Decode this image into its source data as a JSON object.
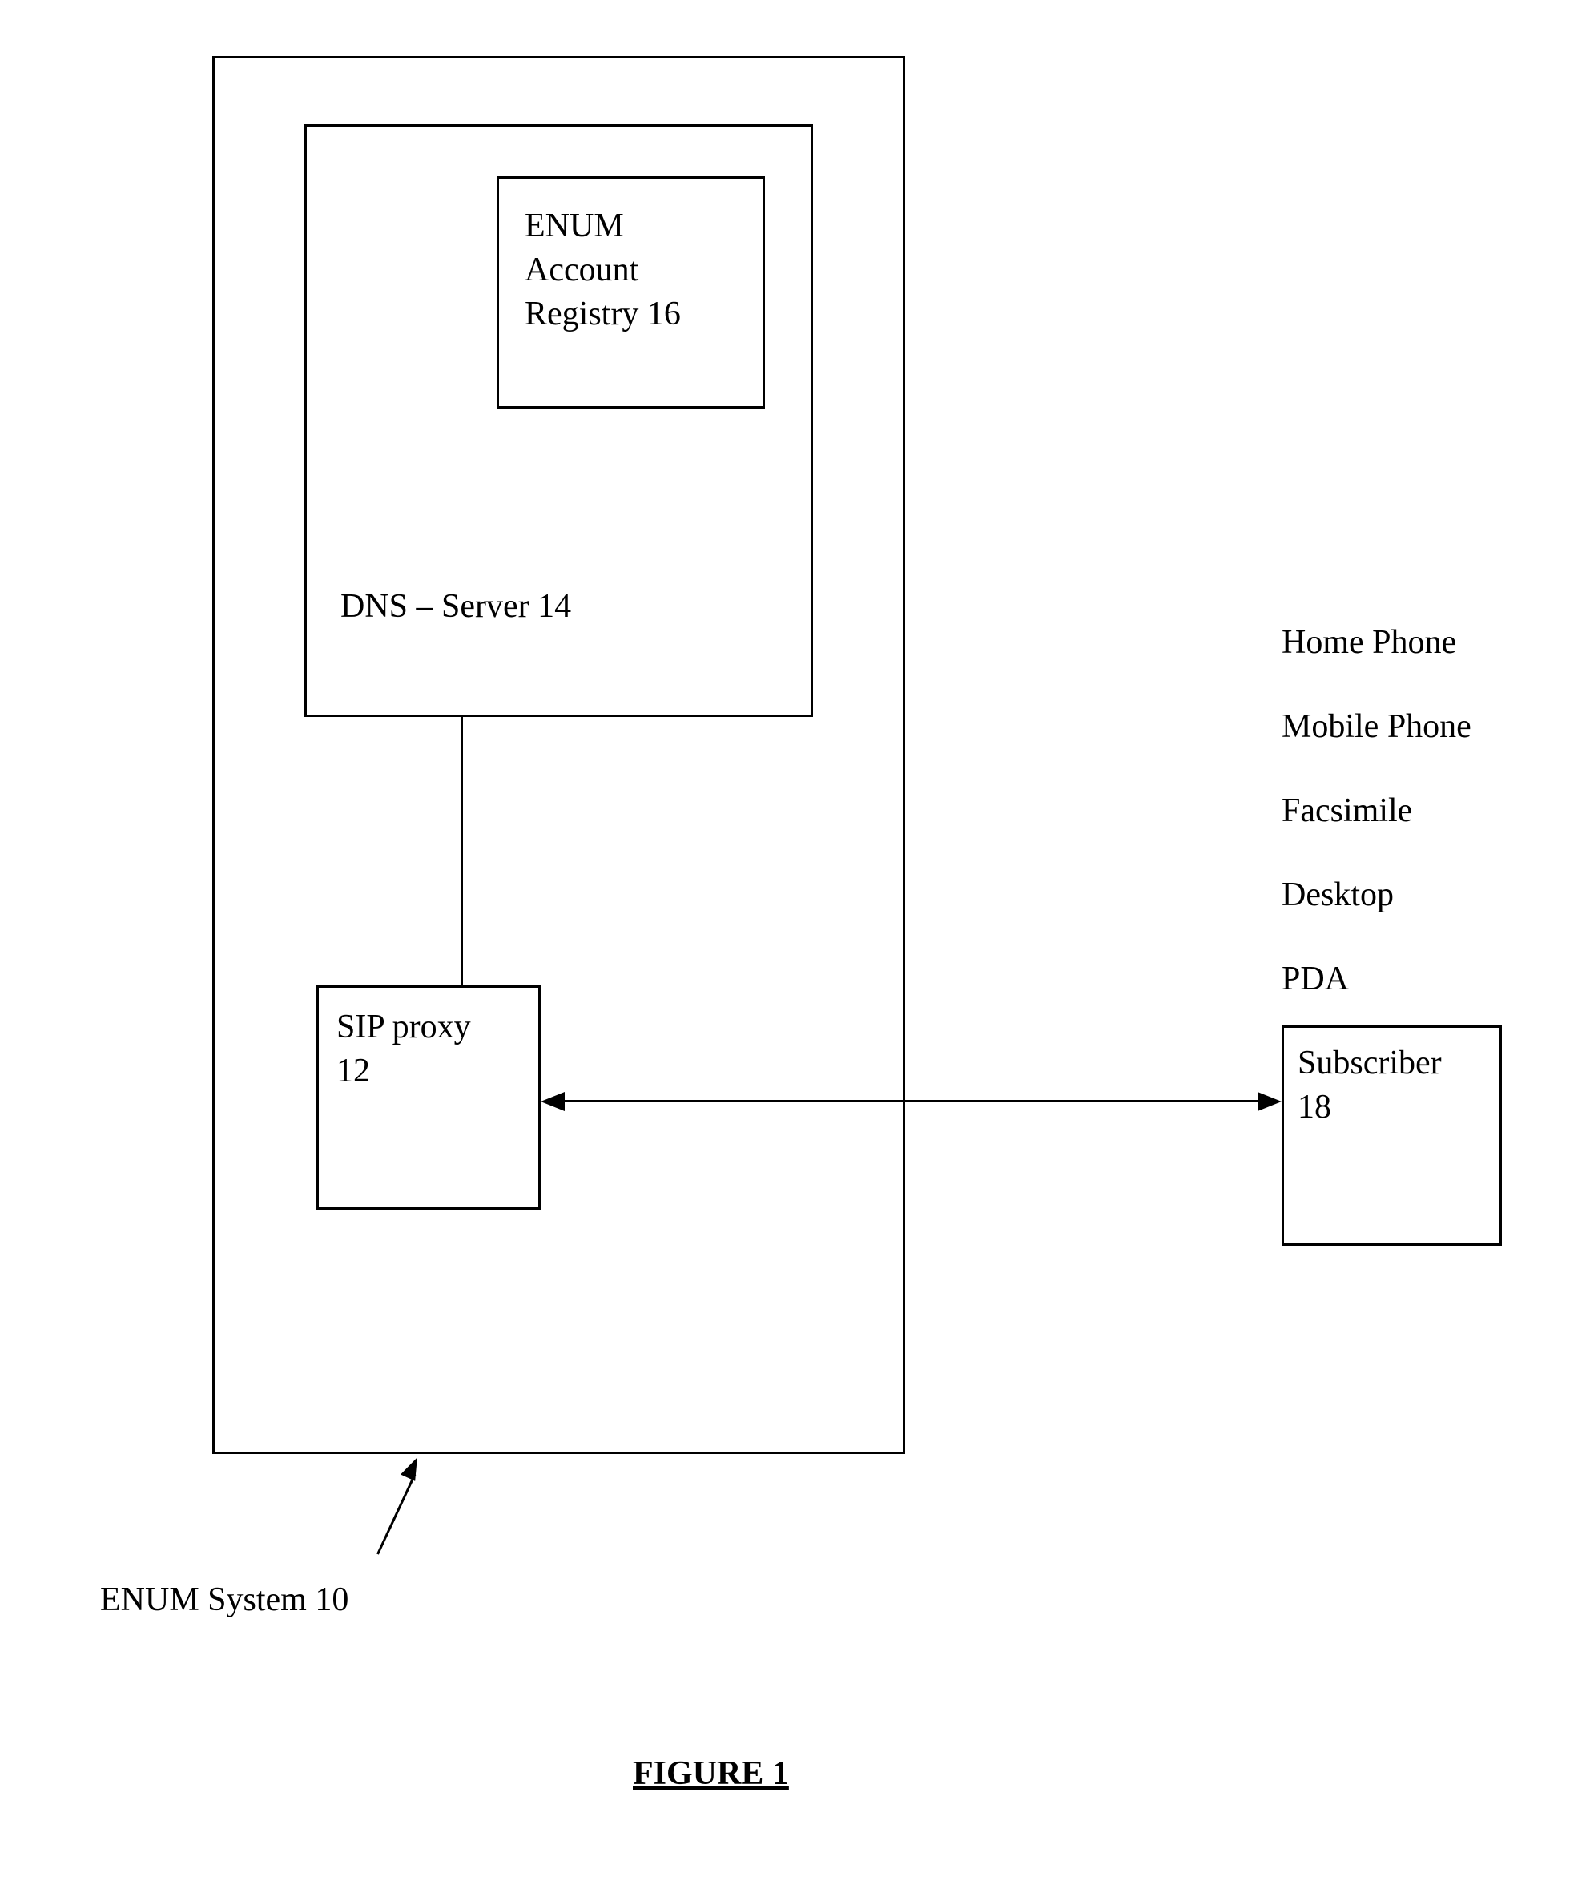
{
  "enum_system": {
    "label": "ENUM System 10",
    "dns_server": {
      "label": "DNS – Server 14",
      "registry": {
        "line1": "ENUM",
        "line2": "Account",
        "line3": "Registry 16"
      }
    },
    "sip_proxy": {
      "line1": "SIP proxy",
      "line2": "12"
    }
  },
  "subscriber": {
    "line1": "Subscriber",
    "line2": "18"
  },
  "devices": {
    "home_phone": "Home Phone",
    "mobile_phone": "Mobile Phone",
    "facsimile": "Facsimile",
    "desktop": "Desktop",
    "pda": "PDA"
  },
  "figure_title": "FIGURE 1"
}
